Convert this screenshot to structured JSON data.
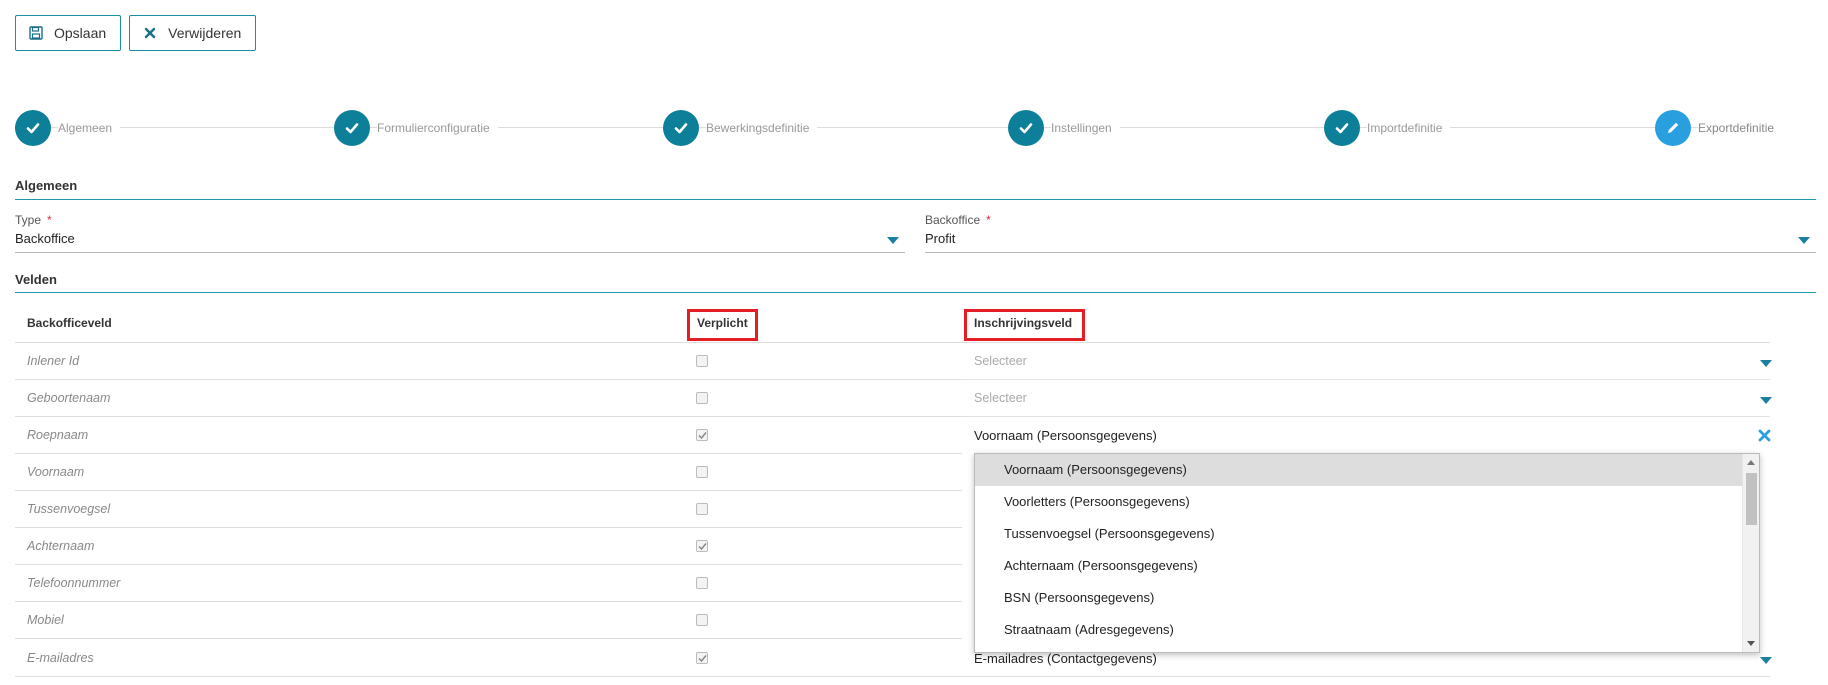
{
  "toolbar": {
    "save_label": "Opslaan",
    "delete_label": "Verwijderen"
  },
  "steps": [
    {
      "label": "Algemeen",
      "state": "done"
    },
    {
      "label": "Formulierconfiguratie",
      "state": "done"
    },
    {
      "label": "Bewerkingsdefinitie",
      "state": "done"
    },
    {
      "label": "Instellingen",
      "state": "done"
    },
    {
      "label": "Importdefinitie",
      "state": "done"
    },
    {
      "label": "Exportdefinitie",
      "state": "active"
    }
  ],
  "general": {
    "title": "Algemeen",
    "type_label": "Type",
    "type_value": "Backoffice",
    "backoffice_label": "Backoffice",
    "backoffice_value": "Profit",
    "required_mark": "*"
  },
  "fields": {
    "title": "Velden",
    "col_backofficeveld": "Backofficeveld",
    "col_verplicht": "Verplicht",
    "col_inschrijvingsveld": "Inschrijvingsveld",
    "rows": [
      {
        "name": "Inlener Id",
        "required": false,
        "value": "Selecteer",
        "placeholder": true
      },
      {
        "name": "Geboortenaam",
        "required": false,
        "value": "Selecteer",
        "placeholder": true
      },
      {
        "name": "Roepnaam",
        "required": true,
        "value": "Voornaam (Persoonsgegevens)",
        "placeholder": false
      },
      {
        "name": "Voornaam",
        "required": false,
        "value": "",
        "placeholder": false
      },
      {
        "name": "Tussenvoegsel",
        "required": false,
        "value": "",
        "placeholder": false
      },
      {
        "name": "Achternaam",
        "required": true,
        "value": "",
        "placeholder": false
      },
      {
        "name": "Telefoonnummer",
        "required": false,
        "value": "",
        "placeholder": false
      },
      {
        "name": "Mobiel",
        "required": false,
        "value": "",
        "placeholder": false
      },
      {
        "name": "E-mailadres",
        "required": true,
        "value": "E-mailadres (Contactgegevens)",
        "placeholder": false
      }
    ]
  },
  "dropdown": {
    "options": [
      "Voornaam (Persoonsgegevens)",
      "Voorletters (Persoonsgegevens)",
      "Tussenvoegsel (Persoonsgegevens)",
      "Achternaam (Persoonsgegevens)",
      "BSN (Persoonsgegevens)",
      "Straatnaam (Adresgegevens)"
    ],
    "hovered_index": 0
  },
  "colors": {
    "accent": "#0d7f99",
    "active_step": "#2a9fe0",
    "highlight": "#e31e24",
    "required": "#e0283a"
  }
}
